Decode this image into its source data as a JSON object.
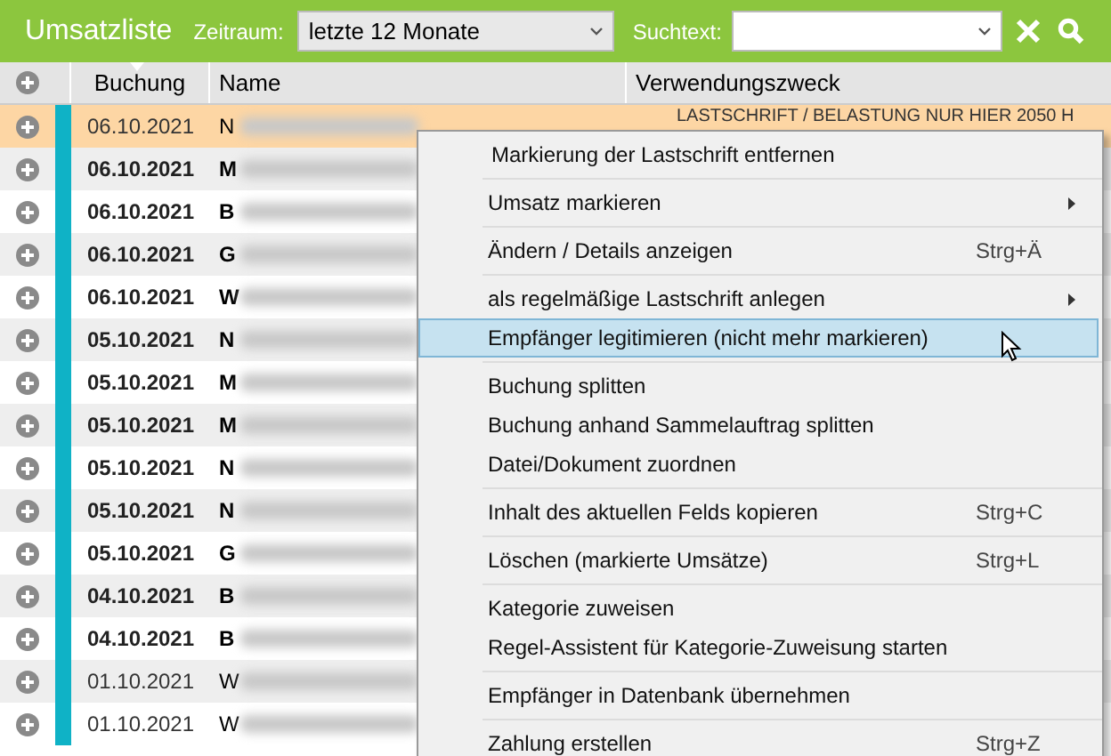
{
  "toolbar": {
    "title": "Umsatzliste",
    "period_label": "Zeitraum:",
    "period_value": "letzte 12 Monate",
    "search_label": "Suchtext:"
  },
  "table": {
    "columns": [
      "Buchung",
      "Name",
      "Verwendungszweck"
    ],
    "rows": [
      {
        "date": "06.10.2021",
        "name": "N",
        "purpose": "LASTSCHRIFT / BELASTUNG NUR HIER 2050 H",
        "selected": true,
        "bold": false
      },
      {
        "date": "06.10.2021",
        "name": "M",
        "selected": false,
        "bold": true
      },
      {
        "date": "06.10.2021",
        "name": "B",
        "selected": false,
        "bold": true
      },
      {
        "date": "06.10.2021",
        "name": "G",
        "selected": false,
        "bold": true
      },
      {
        "date": "06.10.2021",
        "name": "W",
        "selected": false,
        "bold": true
      },
      {
        "date": "05.10.2021",
        "name": "N",
        "selected": false,
        "bold": true
      },
      {
        "date": "05.10.2021",
        "name": "M",
        "selected": false,
        "bold": true
      },
      {
        "date": "05.10.2021",
        "name": "M",
        "selected": false,
        "bold": true
      },
      {
        "date": "05.10.2021",
        "name": "N",
        "selected": false,
        "bold": true
      },
      {
        "date": "05.10.2021",
        "name": "N",
        "selected": false,
        "bold": true
      },
      {
        "date": "05.10.2021",
        "name": "G",
        "selected": false,
        "bold": true
      },
      {
        "date": "04.10.2021",
        "name": "B",
        "selected": false,
        "bold": true
      },
      {
        "date": "04.10.2021",
        "name": "B",
        "selected": false,
        "bold": true
      },
      {
        "date": "01.10.2021",
        "name": "W",
        "selected": false,
        "bold": false
      },
      {
        "date": "01.10.2021",
        "name": "W",
        "selected": false,
        "bold": false
      }
    ]
  },
  "context_menu": {
    "groups": [
      [
        {
          "label": "Markierung der Lastschrift entfernen",
          "selected": false
        }
      ],
      [
        {
          "label": "Umsatz markieren",
          "submenu": true,
          "selected": false
        }
      ],
      [
        {
          "label": "Ändern / Details anzeigen",
          "shortcut": "Strg+Ä",
          "selected": false
        }
      ],
      [
        {
          "label": "als regelmäßige Lastschrift anlegen",
          "submenu": true,
          "selected": false
        },
        {
          "label": "Empfänger legitimieren (nicht mehr markieren)",
          "selected": true
        }
      ],
      [
        {
          "label": "Buchung splitten",
          "selected": false
        },
        {
          "label": "Buchung anhand Sammelauftrag splitten",
          "selected": false
        },
        {
          "label": "Datei/Dokument zuordnen",
          "selected": false
        }
      ],
      [
        {
          "label": "Inhalt des aktuellen Felds kopieren",
          "shortcut": "Strg+C",
          "selected": false
        }
      ],
      [
        {
          "label": "Löschen (markierte Umsätze)",
          "shortcut": "Strg+L",
          "selected": false
        }
      ],
      [
        {
          "label": "Kategorie zuweisen",
          "selected": false
        },
        {
          "label": "Regel-Assistent für Kategorie-Zuweisung starten",
          "selected": false
        }
      ],
      [
        {
          "label": "Empfänger in Datenbank übernehmen",
          "selected": false
        }
      ],
      [
        {
          "label": "Zahlung erstellen",
          "shortcut": "Strg+Z",
          "selected": false
        }
      ]
    ]
  }
}
